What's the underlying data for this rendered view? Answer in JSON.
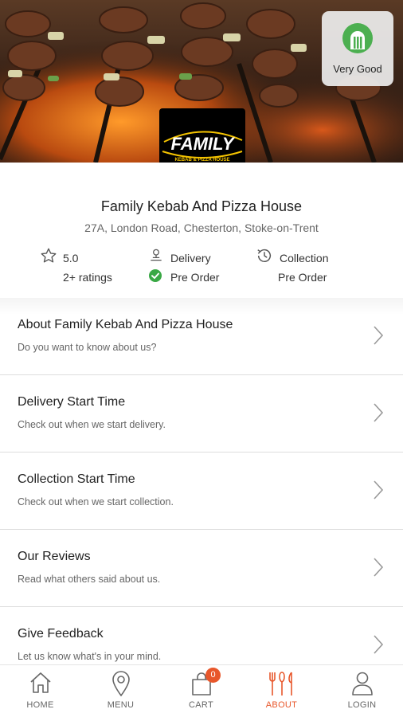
{
  "header": {
    "rating_badge": {
      "label": "Very Good",
      "icon": "hygiene-rating-icon",
      "color": "#4caf50"
    },
    "brand_logo": {
      "wordmark": "FAMILY",
      "subtitle": "KEBAB & PIZZA HOUSE",
      "color": "#ffffff",
      "accent": "#f5c400"
    }
  },
  "restaurant": {
    "name": "Family Kebab And Pizza House",
    "address": "27A, London Road, Chesterton, Stoke-on-Trent"
  },
  "stats": {
    "rating": {
      "value": "5.0",
      "count": "2+ ratings",
      "icon": "star-icon"
    },
    "delivery": {
      "label": "Delivery",
      "status": "Pre Order",
      "icon": "delivery-icon",
      "status_icon": "check-circle-icon",
      "status_color": "#3aa845"
    },
    "collection": {
      "label": "Collection",
      "status": "Pre Order",
      "icon": "clock-history-icon"
    }
  },
  "menu": [
    {
      "title": "About Family Kebab And Pizza House",
      "subtitle": "Do you want to know about us?"
    },
    {
      "title": "Delivery Start Time",
      "subtitle": "Check out when we start delivery."
    },
    {
      "title": "Collection Start Time",
      "subtitle": "Check out when we start collection."
    },
    {
      "title": "Our Reviews",
      "subtitle": "Read what others said about us."
    },
    {
      "title": "Give Feedback",
      "subtitle": "Let us know what's in your mind."
    }
  ],
  "tabbar": {
    "accent": "#e8572b",
    "cart_count": "0",
    "items": [
      {
        "label": "HOME",
        "icon": "home-icon"
      },
      {
        "label": "MENU",
        "icon": "location-pin-icon"
      },
      {
        "label": "CART",
        "icon": "shopping-bag-icon"
      },
      {
        "label": "ABOUT",
        "icon": "cutlery-icon"
      },
      {
        "label": "LOGIN",
        "icon": "user-icon"
      }
    ]
  }
}
